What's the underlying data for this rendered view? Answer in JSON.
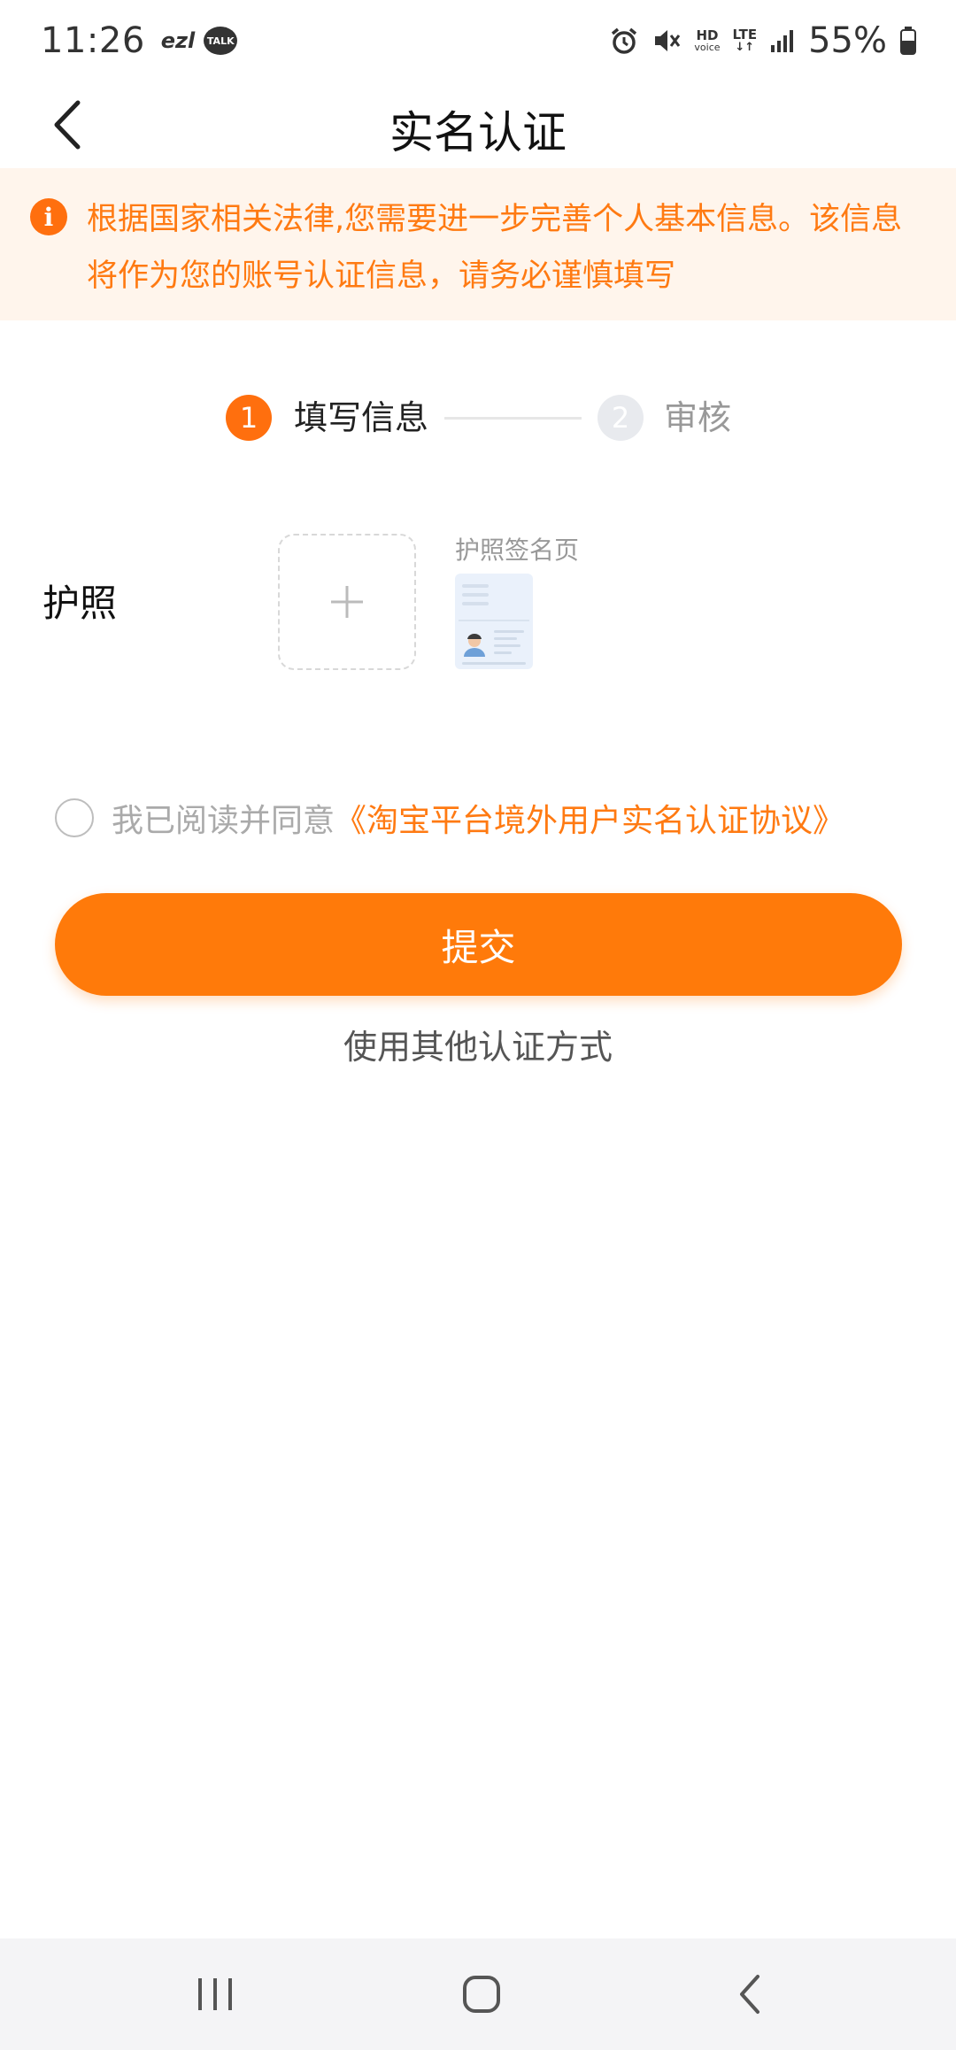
{
  "status_bar": {
    "time": "11:26",
    "carrier_tag": "ezl",
    "talk_badge": "TALK",
    "hd_label": "HD",
    "voice_label": "voice",
    "lte_label": "LTE",
    "battery": "55%",
    "icons": [
      "alarm-icon",
      "mute-icon",
      "signal-icon",
      "battery-icon"
    ]
  },
  "header": {
    "title": "实名认证",
    "back_icon": "chevron-left-icon"
  },
  "notice": {
    "icon": "info-icon",
    "icon_glyph": "i",
    "text": "根据国家相关法律,您需要进一步完善个人基本信息。该信息将作为您的账号认证信息，请务必谨慎填写"
  },
  "steps": [
    {
      "number": "1",
      "label": "填写信息",
      "state": "active"
    },
    {
      "number": "2",
      "label": "审核",
      "state": "inactive"
    }
  ],
  "passport": {
    "label": "护照",
    "upload_icon": "plus-icon",
    "sample_caption": "护照签名页"
  },
  "agreement": {
    "text": "我已阅读并同意",
    "link": "《淘宝平台境外用户实名认证协议》",
    "checked": false
  },
  "submit_label": "提交",
  "alt_method": "使用其他认证方式",
  "nav_bar": {
    "icons": [
      "recent-apps-icon",
      "home-icon",
      "back-icon"
    ]
  },
  "colors": {
    "accent": "#ff7a0a",
    "notice_bg": "#fff5ec",
    "notice_text": "#ff7a12",
    "muted": "#999999"
  }
}
